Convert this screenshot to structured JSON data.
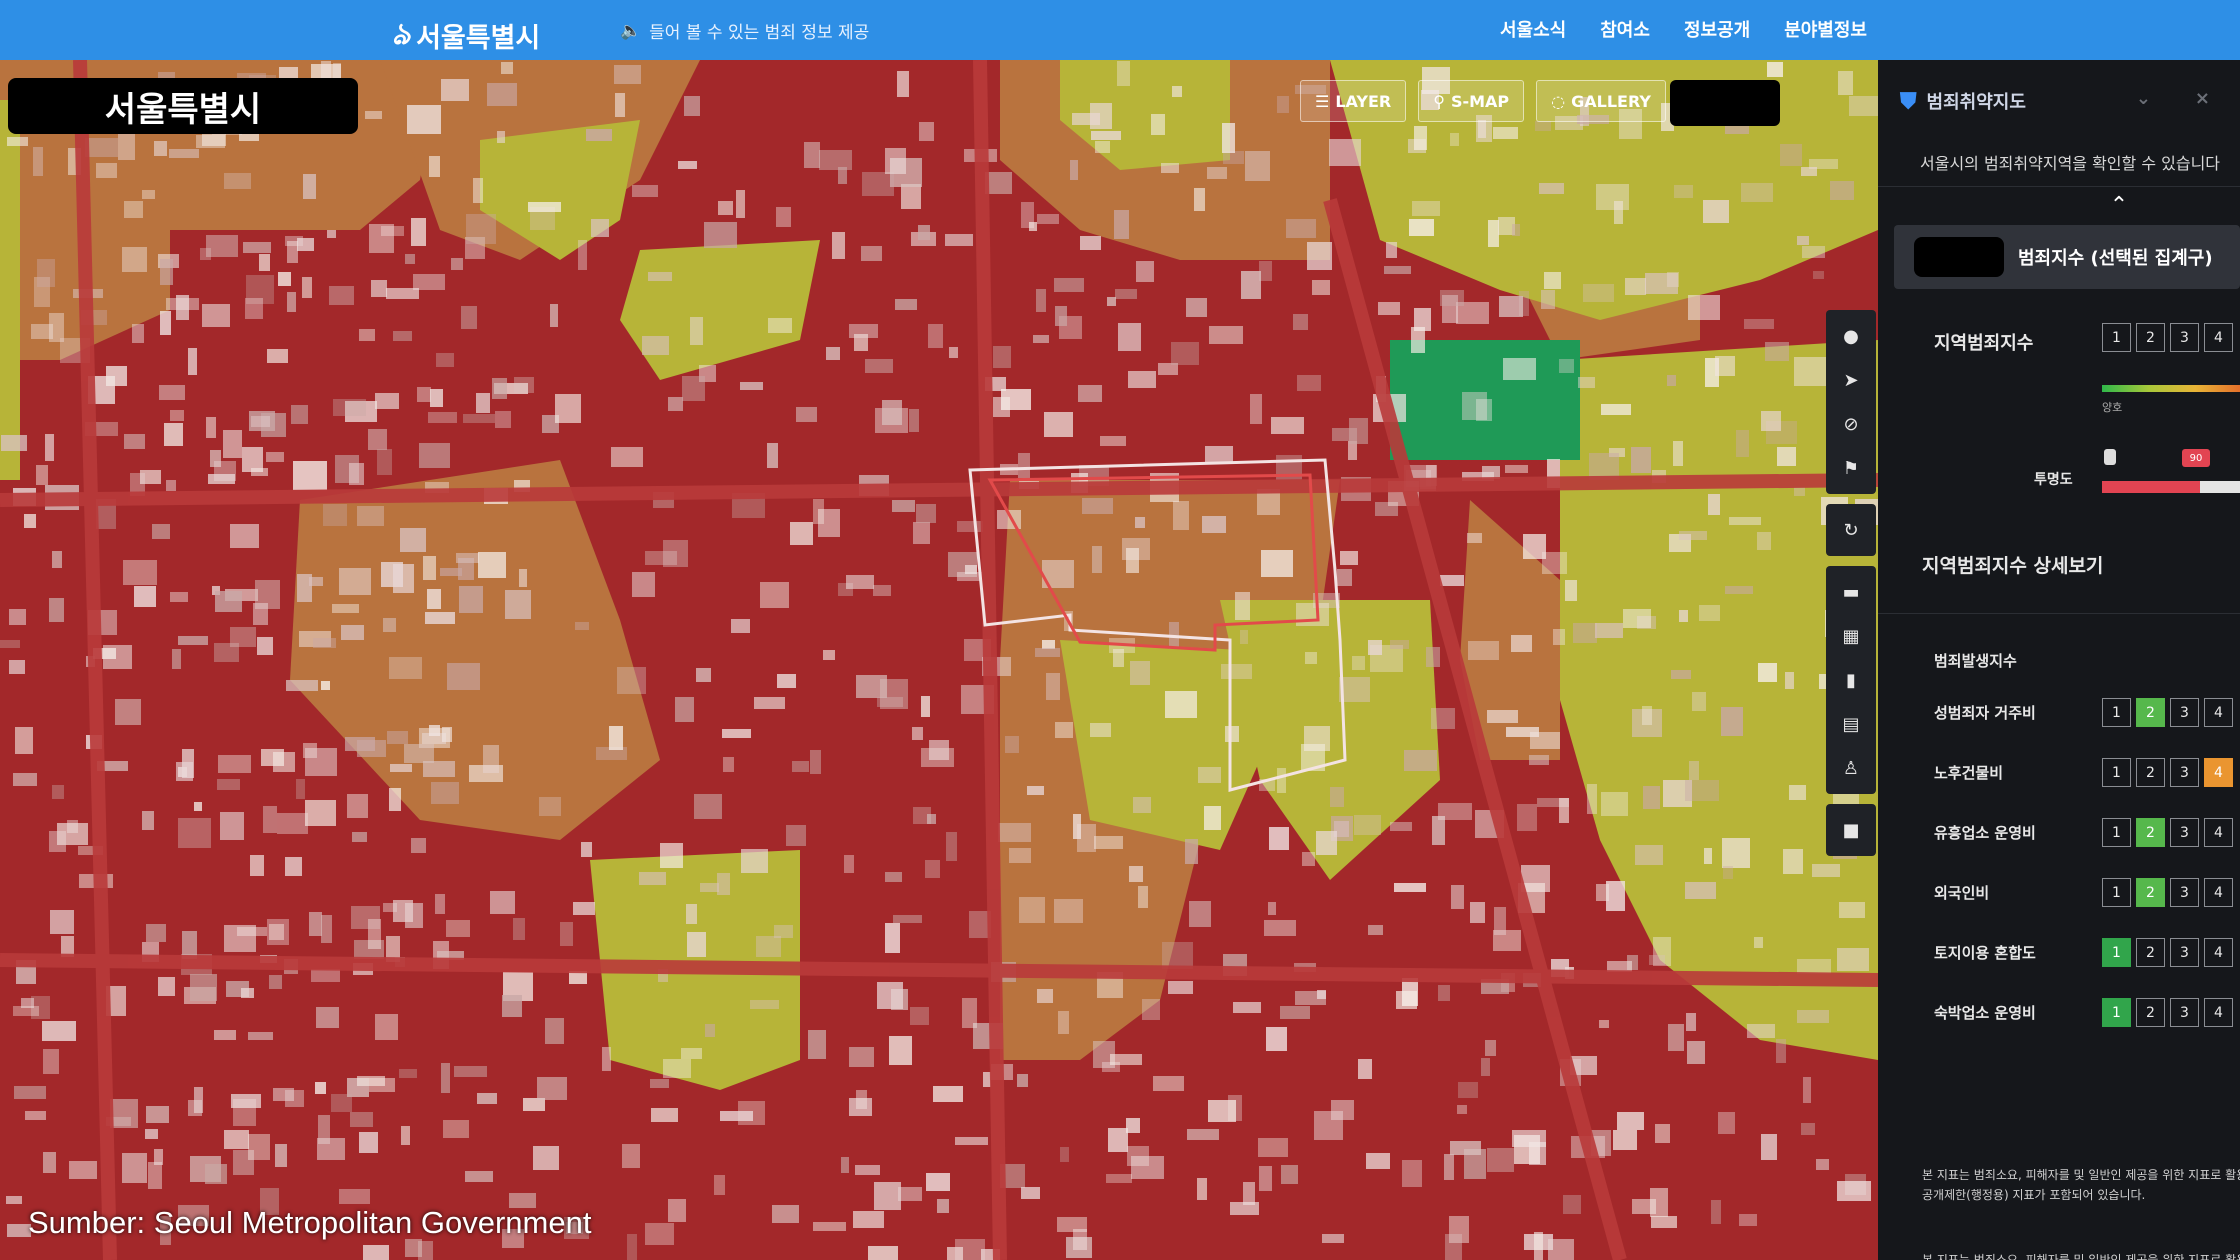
{
  "header": {
    "logo": "서울특별시",
    "notice": "들어 볼 수 있는 범죄 정보 제공",
    "nav": [
      "서울소식",
      "참여소",
      "정보공개",
      "분야별정보"
    ]
  },
  "map": {
    "city_label": "서울특별시",
    "tools": [
      "LAYER",
      "S-MAP",
      "GALLERY"
    ],
    "source_caption": "Sumber: Seoul Metropolitan Government",
    "legend_colors": {
      "high": "#b5272b",
      "mid": "#c47a3e",
      "low": "#b9b536",
      "safe": "#1f9a57"
    }
  },
  "panel": {
    "title": "범죄취약지도",
    "description": "서울시의 범죄취약지역을 확인할 수 있습니다",
    "selected_index": "범죄지수 (선택된 집계구)",
    "regional_index_label": "지역범죄지수",
    "scale_numbers": [
      "1",
      "2",
      "3",
      "4"
    ],
    "gradient_label": "양호",
    "opacity_label": "투명도",
    "opacity_badge": "90",
    "opacity_value": 0.7,
    "detail_title": "지역범죄지수 상세보기",
    "category_title": "범죄발생지수",
    "rows": [
      {
        "label": "성범죄자 거주비",
        "level": 2
      },
      {
        "label": "노후건물비",
        "level": 4
      },
      {
        "label": "유흥업소 운영비",
        "level": 2
      },
      {
        "label": "외국인비",
        "level": 2
      },
      {
        "label": "토지이용 혼합도",
        "level": 1
      },
      {
        "label": "숙박업소 운영비",
        "level": 1
      }
    ],
    "footnote": "본 지표는 범죄소요, 피해자를 및 일반인 제공을 위한 지표로 활용되며, 공개제한(행정용) 지표가 포함되어 있습니다.",
    "footnote_repeat": "본 지표는 범죄소요, 피해자를 및 일반인 제공을 위한 지표로 활용되며, 공개제한(행정용) 지표가 포함되어 있습니다."
  }
}
